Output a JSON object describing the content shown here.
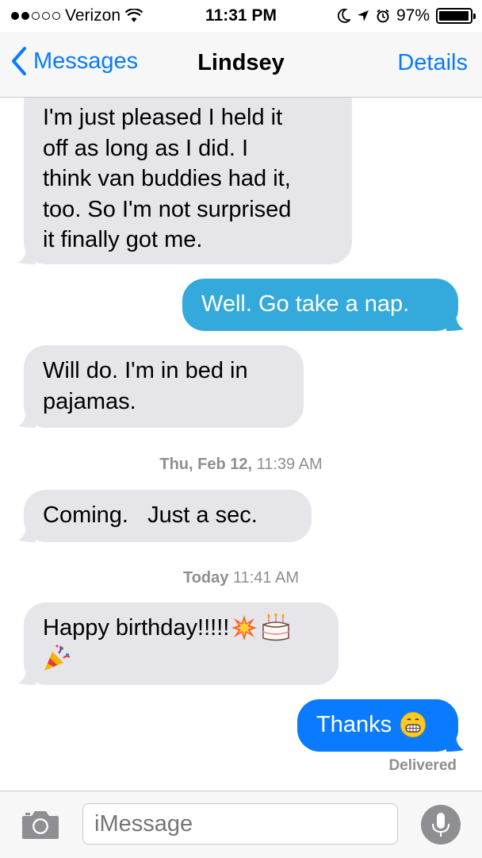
{
  "status_bar": {
    "carrier": "Verizon",
    "signal_bars_filled": 2,
    "signal_bars_total": 5,
    "time": "11:31 PM",
    "battery": "97%",
    "battery_level": 0.97
  },
  "nav": {
    "back_label": "Messages",
    "title": "Lindsey",
    "details_label": "Details"
  },
  "messages": [
    {
      "direction": "incoming",
      "text": "I'm just pleased I held it\noff as long as I did. I\nthink van buddies had it,\ntoo. So I'm not surprised\nit finally got me."
    },
    {
      "direction": "outgoing",
      "service": "sms",
      "text": "Well. Go take a nap."
    },
    {
      "direction": "incoming",
      "text": "Will do. I'm in bed in\npajamas."
    },
    {
      "direction": "incoming",
      "text": "Coming.   Just a sec."
    },
    {
      "direction": "incoming",
      "text": "Happy birthday!!!!!",
      "emoji": [
        "collision-emoji",
        "birthday-cake-emoji",
        "party-popper-emoji"
      ]
    },
    {
      "direction": "outgoing",
      "service": "imessage",
      "text": "Thanks",
      "emoji": [
        "grinning-emoji"
      ]
    }
  ],
  "timestamps": [
    {
      "day": "Thu, Feb 12,",
      "time": "11:39 AM"
    },
    {
      "day": "Today",
      "time": "11:41 AM"
    }
  ],
  "delivery_status": "Delivered",
  "input": {
    "placeholder": "iMessage",
    "camera_icon": "camera-icon",
    "mic_icon": "microphone-icon"
  },
  "colors": {
    "ios_blue": "#0a7aff",
    "sms_green": "#34aadc",
    "incoming_gray": "#e5e5ea",
    "meta_gray": "#8e8e93"
  }
}
